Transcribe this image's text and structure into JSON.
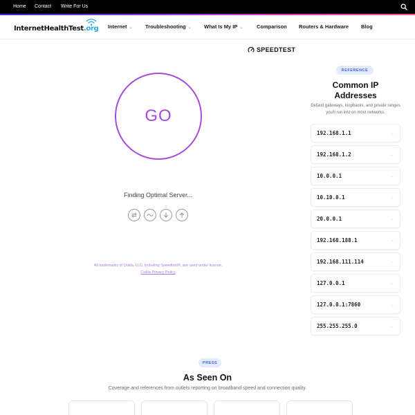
{
  "topbar": {
    "links": [
      "Home",
      "Contact",
      "Write For Us"
    ]
  },
  "header": {
    "logo_main": "InternetHealthTest",
    "logo_tld": ".org",
    "nav": [
      {
        "label": "Internet",
        "dropdown": true
      },
      {
        "label": "Troubleshooting",
        "dropdown": true
      },
      {
        "label": "What Is My IP",
        "dropdown": true
      },
      {
        "label": "Comparison",
        "dropdown": false
      },
      {
        "label": "Routers & Hardware",
        "dropdown": false
      },
      {
        "label": "Blog",
        "dropdown": false
      }
    ]
  },
  "speedtest": {
    "brand": "SPEEDTEST",
    "go_label": "GO",
    "status": "Finding Optimal Server...",
    "trademark": "All trademarks of Ookla, LLC, including Speedtest®, are used under license.",
    "privacy_link": "Ookla Privacy Policy"
  },
  "sidebar": {
    "badge": "REFERENCE",
    "title": "Common IP Addresses",
    "description": "Default gateways, loopbacks, and private ranges you'll run into on most networks.",
    "ips": [
      "192.168.1.1",
      "192.168.1.2",
      "10.0.0.1",
      "10.10.0.1",
      "20.0.0.1",
      "192.168.188.1",
      "192.168.111.114",
      "127.0.0.1",
      "127.0.0.1:7860",
      "255.255.255.0"
    ],
    "arrow_glyph": "→"
  },
  "press": {
    "badge": "PRESS",
    "title": "As Seen On",
    "description": "Coverage and references from outlets reporting on broadband speed and connection quality."
  },
  "colors": {
    "accent_purple": "#a24bdc",
    "brand_blue": "#2aa7e0",
    "badge_bg": "#e3ecff",
    "badge_text": "#3b66e0"
  },
  "icons": {
    "top_search": "search-icon",
    "logo_wifi": "wifi-icon",
    "speedtest_logo": "speedtest-gauge-icon",
    "test_steps": [
      "server-exchange-icon",
      "ping-wave-icon",
      "download-arrow-icon",
      "upload-arrow-icon"
    ]
  }
}
